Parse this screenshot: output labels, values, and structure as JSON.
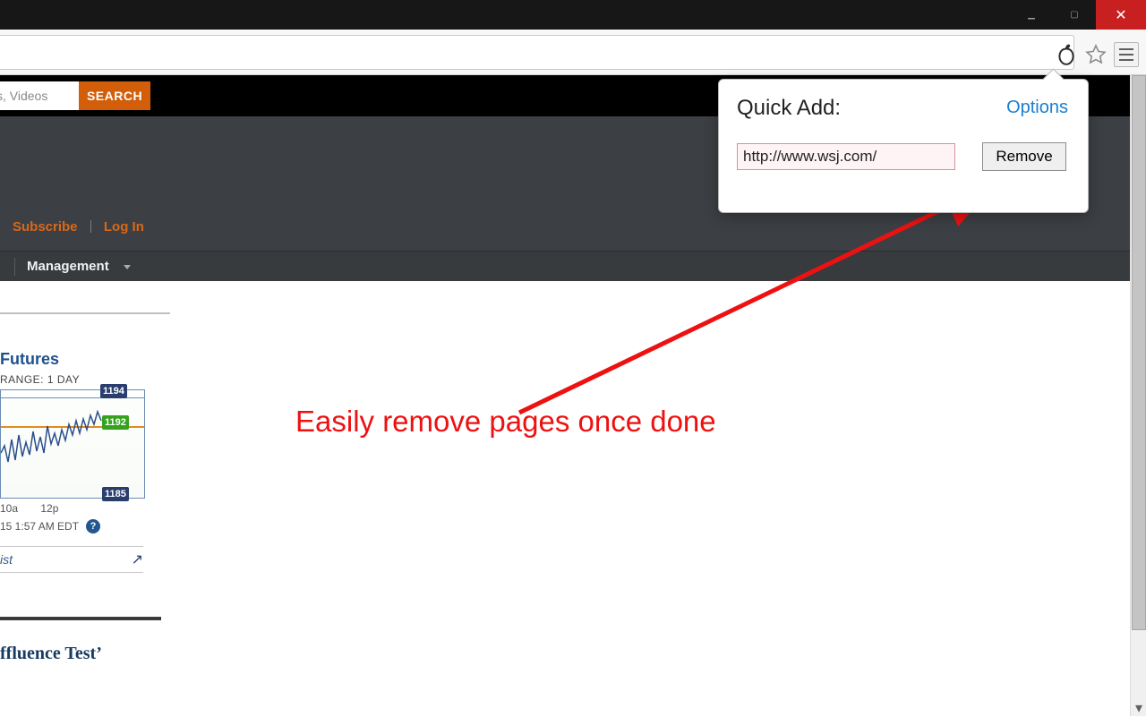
{
  "titlebar": {
    "close_label": "✕",
    "min_label": "▁",
    "max_label": "▢"
  },
  "page": {
    "search": {
      "placeholder": "s, Videos",
      "button": "SEARCH"
    },
    "account": {
      "subscribe": "Subscribe",
      "login": "Log In"
    },
    "nav": {
      "item": "Management"
    },
    "sidebar": {
      "futures_label": "Futures",
      "range_label": "RANGE: 1 DAY",
      "values": {
        "high": "1194",
        "current": "1192",
        "low": "1185"
      },
      "xaxis": {
        "t1": "10a",
        "t2": "12p"
      },
      "timestamp": "15 1:57 AM EDT",
      "ist_label": "ist",
      "headline": "ffluence Test’"
    }
  },
  "popup": {
    "title": "Quick Add:",
    "options": "Options",
    "input_value": "http://www.wsj.com/",
    "remove": "Remove"
  },
  "annotation": {
    "text": "Easily remove pages once done"
  }
}
